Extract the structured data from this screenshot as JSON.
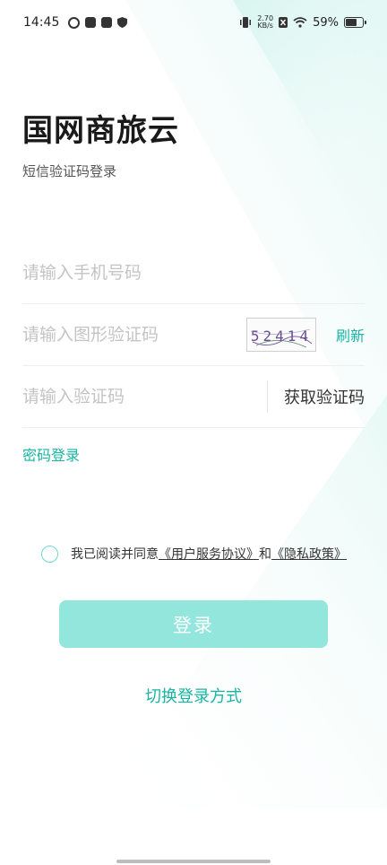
{
  "status_bar": {
    "time": "14:45",
    "net_speed_value": "2.70",
    "net_speed_unit": "KB/s",
    "battery": "59%",
    "icons": [
      "sync-icon",
      "tiktok-icon",
      "mail-icon",
      "shield-icon",
      "vibrate-icon",
      "net-speed-icon",
      "sim-off-icon",
      "wifi-icon",
      "battery-icon"
    ]
  },
  "header": {
    "title": "国网商旅云",
    "subtitle": "短信验证码登录"
  },
  "form": {
    "phone_placeholder": "请输入手机号码",
    "captcha_placeholder": "请输入图形验证码",
    "captcha_text": "52414",
    "refresh_label": "刷新",
    "sms_placeholder": "请输入验证码",
    "get_code_label": "获取验证码"
  },
  "password_login_label": "密码登录",
  "agreement": {
    "prefix": "我已阅读并同意",
    "user_agreement": "《用户服务协议》",
    "conjunction": "和",
    "privacy_policy": "《隐私政策》",
    "checked": false
  },
  "login_button_label": "登录",
  "switch_login_label": "切换登录方式",
  "colors": {
    "accent": "#18b5a4",
    "button_bg": "#92e6dc",
    "checkbox_border": "#6fd6cb"
  }
}
